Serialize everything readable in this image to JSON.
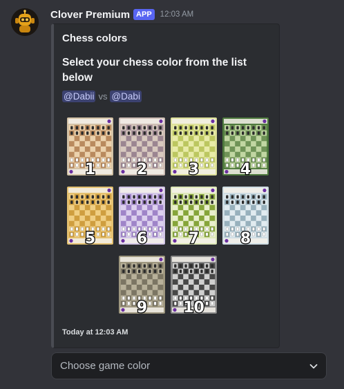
{
  "message": {
    "username": "Clover Premium",
    "app_tag": "APP",
    "timestamp": "12:03 AM",
    "avatar_icon": "robot-bot-icon"
  },
  "embed": {
    "title": "Chess colors",
    "description": "Select your chess color from the list below",
    "mention_1": "@Dabii",
    "vs_text": "vs",
    "mention_2": "@Dabi",
    "footer": "Today at 12:03 AM",
    "accent_color": "#4a4c53"
  },
  "board_options": [
    {
      "number": "1",
      "light": "#ecd2ad",
      "dark": "#b98a5e",
      "frame": "#d3c2a6"
    },
    {
      "number": "2",
      "light": "#d8c9bf",
      "dark": "#9b8591",
      "frame": "#cdbdb4"
    },
    {
      "number": "3",
      "light": "#e8eba8",
      "dark": "#bcc760",
      "frame": "#dde09a"
    },
    {
      "number": "4",
      "light": "#c1d6a2",
      "dark": "#6f9357",
      "frame": "#4f7a3e"
    },
    {
      "number": "5",
      "light": "#f0cf84",
      "dark": "#cf9e3f",
      "frame": "#e3c070"
    },
    {
      "number": "6",
      "light": "#dcd0ee",
      "dark": "#9f84c8",
      "frame": "#d2c6e6"
    },
    {
      "number": "7",
      "light": "#e9efcd",
      "dark": "#86a53a",
      "frame": "#dde7b8"
    },
    {
      "number": "8",
      "light": "#e1ebf0",
      "dark": "#98b1bd",
      "frame": "#cfdde3"
    },
    {
      "number": "9",
      "light": "#b8b19a",
      "dark": "#7b7563",
      "frame": "#9e977f"
    },
    {
      "number": "10",
      "light": "#cfcfcf",
      "dark": "#474747",
      "frame": "#8a8a8a"
    }
  ],
  "select_menu": {
    "placeholder": "Choose game color"
  },
  "colors": {
    "background": "#323339",
    "embed_background": "#2b2d31",
    "app_tag": "#5865f2",
    "mention_background": "#3c4270",
    "mention_text": "#c9cdfb"
  }
}
